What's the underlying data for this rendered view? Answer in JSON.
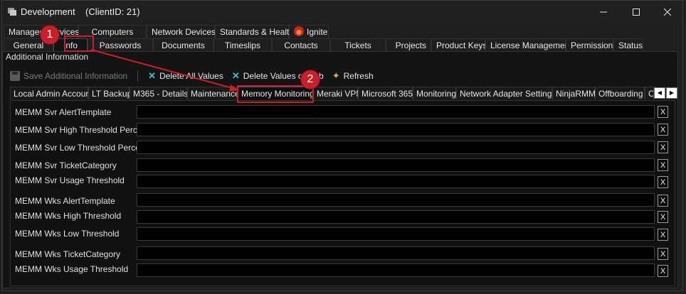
{
  "window": {
    "title": "Development    (ClientID: 21)",
    "minimize_icon": "minimize-icon",
    "maximize_icon": "maximize-icon",
    "close_icon": "close-icon"
  },
  "main_tabs_row1": [
    "Managed Services",
    "Computers",
    "Network Devices",
    "Standards & Health",
    "Ignite"
  ],
  "main_tabs_row2": [
    "General",
    "Info",
    "Passwords",
    "Documents",
    "Timeslips",
    "Contacts",
    "Tickets",
    "Projects",
    "Product Keys",
    "License Management",
    "Permissions",
    "Status"
  ],
  "selected_main_tab": "Info",
  "panel_title": "Additional Information",
  "toolbar": {
    "save": "Save Additional Information",
    "delete_all": "Delete All Values",
    "delete_on_tab": "Delete Values on Tab",
    "refresh": "Refresh"
  },
  "sub_tabs": [
    "Local Admin Account",
    "LT Backup",
    "M365 - Details",
    "Maintenance",
    "Memory Monitoring",
    "Meraki VPN",
    "Microsoft 365",
    "Monitoring",
    "Network Adapter Settings",
    "NinjaRMM",
    "Offboarding",
    "O"
  ],
  "selected_sub_tab": "Memory Monitoring",
  "fields": [
    {
      "label": "MEMM Svr AlertTemplate",
      "value": ""
    },
    {
      "label": "MEMM Svr High Threshold Percent",
      "value": ""
    },
    {
      "label": "MEMM Svr Low Threshold Percent",
      "value": ""
    },
    {
      "label": "MEMM Svr TicketCategory",
      "value": ""
    },
    {
      "label": "MEMM Svr Usage Threshold",
      "value": ""
    },
    {
      "label": "MEMM Wks AlertTemplate",
      "value": ""
    },
    {
      "label": "MEMM Wks High Threshold",
      "value": ""
    },
    {
      "label": "MEMM Wks Low Threshold",
      "value": ""
    },
    {
      "label": "MEMM Wks TicketCategory",
      "value": ""
    },
    {
      "label": "MEMM Wks Usage Threshold",
      "value": ""
    }
  ],
  "clear_label": "X",
  "callouts": [
    "1",
    "2"
  ],
  "colors": {
    "callout": "#c8202a",
    "toolbar_icon": "#3ec3c9",
    "refresh_icon": "#e2b03c"
  }
}
